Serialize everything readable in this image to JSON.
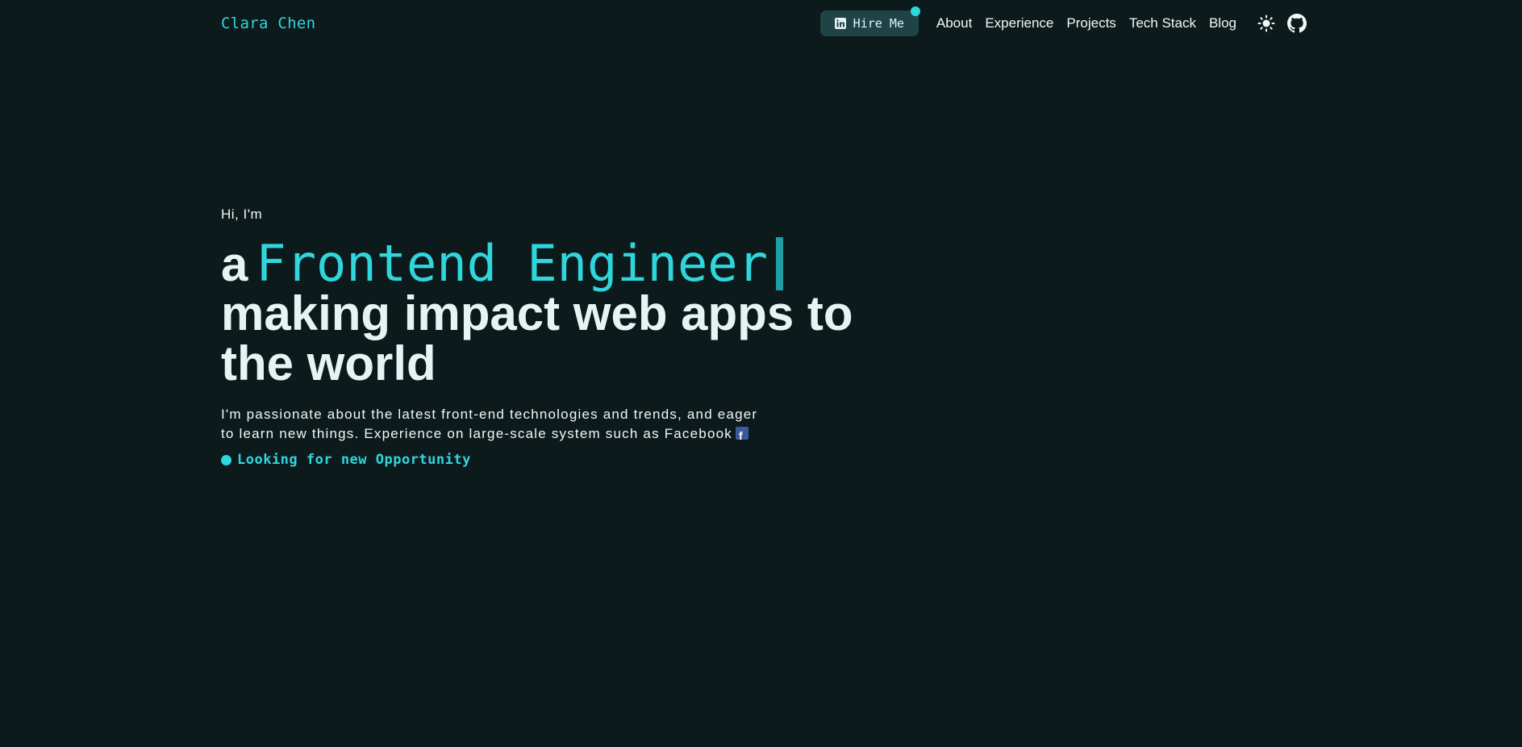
{
  "header": {
    "brand": "Clara Chen",
    "hire_label": "Hire Me",
    "hire_icon": "linkedin-icon",
    "nav": [
      {
        "label": "About"
      },
      {
        "label": "Experience"
      },
      {
        "label": "Projects"
      },
      {
        "label": "Tech Stack"
      },
      {
        "label": "Blog"
      }
    ],
    "theme_icon": "sun-icon",
    "repo_icon": "github-icon"
  },
  "hero": {
    "greeting": "Hi, I'm",
    "headline_prefix": "a",
    "headline_role": "Frontend Engineer",
    "headline_rest": "making impact web apps to the world",
    "description": "I'm passionate about the latest front-end technologies and trends, and eager to learn new things. Experience on large-scale system such as Facebook",
    "description_icon": "facebook-icon",
    "status": "Looking for new Opportunity"
  },
  "colors": {
    "background": "#0d1a1c",
    "accent": "#2fd6dc",
    "button_bg": "#1f4346",
    "text": "#e6f4f4"
  }
}
